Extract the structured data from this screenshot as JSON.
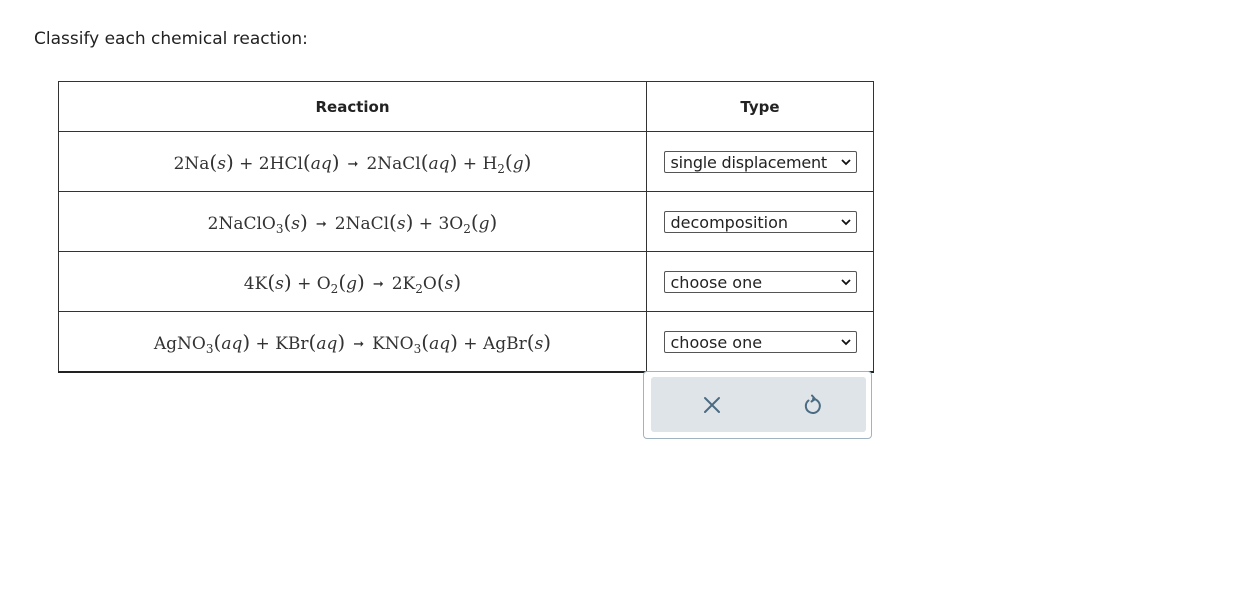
{
  "prompt": "Classify each chemical reaction:",
  "table": {
    "headers": {
      "reaction": "Reaction",
      "type": "Type"
    },
    "rows": [
      {
        "reaction": "2Na(s) + 2HCl(aq) → 2NaCl(aq) + H2(g)",
        "type": "single displacement"
      },
      {
        "reaction": "2NaClO3(s) → 2NaCl(s) + 3O2(g)",
        "type": "decomposition"
      },
      {
        "reaction": "4K(s) + O2(g) → 2K2O(s)",
        "type": "choose one"
      },
      {
        "reaction": "AgNO3(aq) + KBr(aq) → KNO3(aq) + AgBr(s)",
        "type": "choose one"
      }
    ]
  },
  "actions": {
    "clear_icon": "x-icon",
    "undo_icon": "undo-icon"
  },
  "colors": {
    "panel_bg": "#dfe4e8",
    "panel_border": "#9fb4c0",
    "icon": "#4a6b82"
  }
}
